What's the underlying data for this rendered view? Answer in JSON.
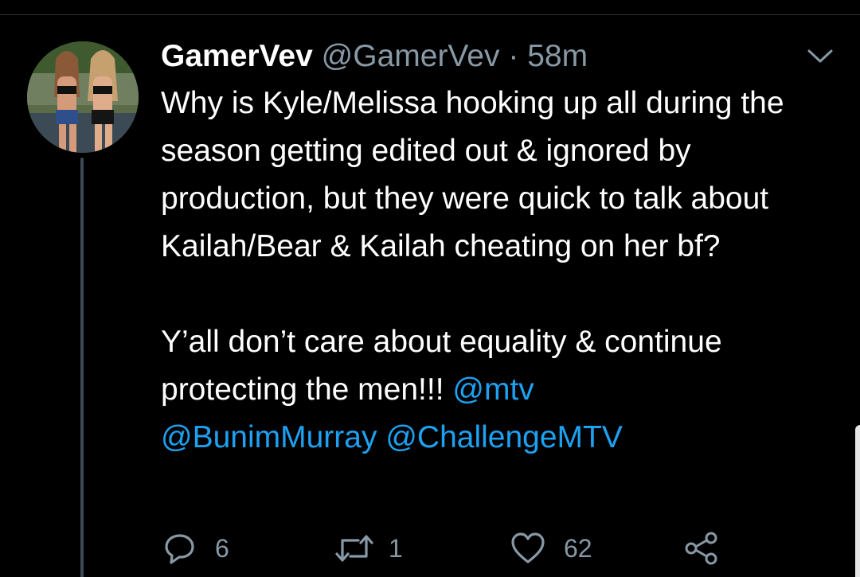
{
  "tweet": {
    "display_name": "GamerVev",
    "handle": "@GamerVev",
    "separator": "·",
    "time": "58m",
    "paragraph_1": "Why is Kyle/Melissa hooking up all during the season getting edited out & ignored by production, but they were quick to talk about Kailah/Bear & Kailah cheating on her bf?",
    "paragraph_2_text": "Y’all don’t care about equality & continue protecting the men!!! ",
    "mentions": [
      "@mtv",
      "@BunimMurray",
      "@ChallengeMTV"
    ]
  },
  "actions": {
    "reply_count": "6",
    "retweet_count": "1",
    "like_count": "62"
  },
  "icons": {
    "menu": "chevron-down-icon",
    "reply": "reply-icon",
    "retweet": "retweet-icon",
    "like": "heart-icon",
    "share": "share-icon"
  },
  "colors": {
    "background": "#000000",
    "text": "#ffffff",
    "secondary": "#8899a6",
    "link": "#1da1f2"
  }
}
